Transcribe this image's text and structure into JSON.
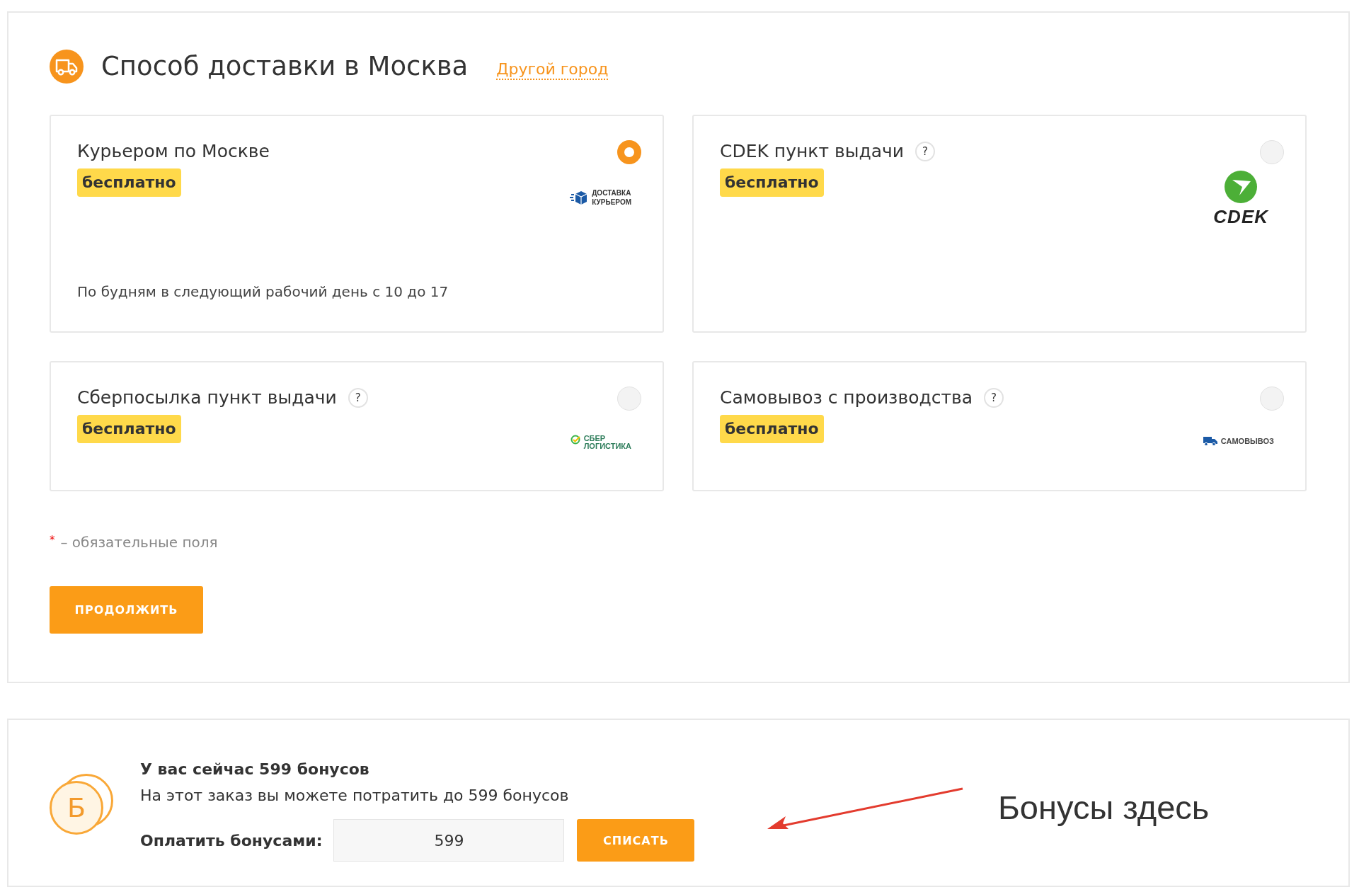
{
  "delivery": {
    "title": "Способ доставки в Москва",
    "city_link": "Другой город",
    "options": [
      {
        "kind": "courier",
        "name": "Курьером по Москве",
        "price": "бесплатно",
        "selected": true,
        "logo_lines": [
          "ДОСТАВКА",
          "КУРЬЕРОМ"
        ],
        "note": "По будням в следующий рабочий день с 10 до 17"
      },
      {
        "kind": "cdek",
        "name": "CDEK пункт выдачи",
        "help": "?",
        "price": "бесплатно",
        "selected": false,
        "logo_lines": [
          "CDEK"
        ]
      },
      {
        "kind": "sber",
        "name": "Сберпосылка пункт выдачи",
        "help": "?",
        "price": "бесплатно",
        "selected": false,
        "logo_lines": [
          "СБЕР",
          "ЛОГИСТИКА"
        ]
      },
      {
        "kind": "pickup",
        "name": "Самовывоз с производства",
        "help": "?",
        "price": "бесплатно",
        "selected": false,
        "logo_lines": [
          "САМОВЫВОЗ"
        ]
      }
    ],
    "required_mark": "*",
    "required_note": "– обязательные поля",
    "continue_button": "ПРОДОЛЖИТЬ"
  },
  "bonuses": {
    "coin_letter": "Б",
    "balance": "У вас сейчас 599 бонусов",
    "limit": "На этот заказ вы можете потратить до 599 бонусов",
    "pay_label": "Оплатить бонусами:",
    "amount": "599",
    "apply_button": "СПИСАТЬ"
  },
  "annotation": {
    "text": "Бонусы здесь"
  }
}
